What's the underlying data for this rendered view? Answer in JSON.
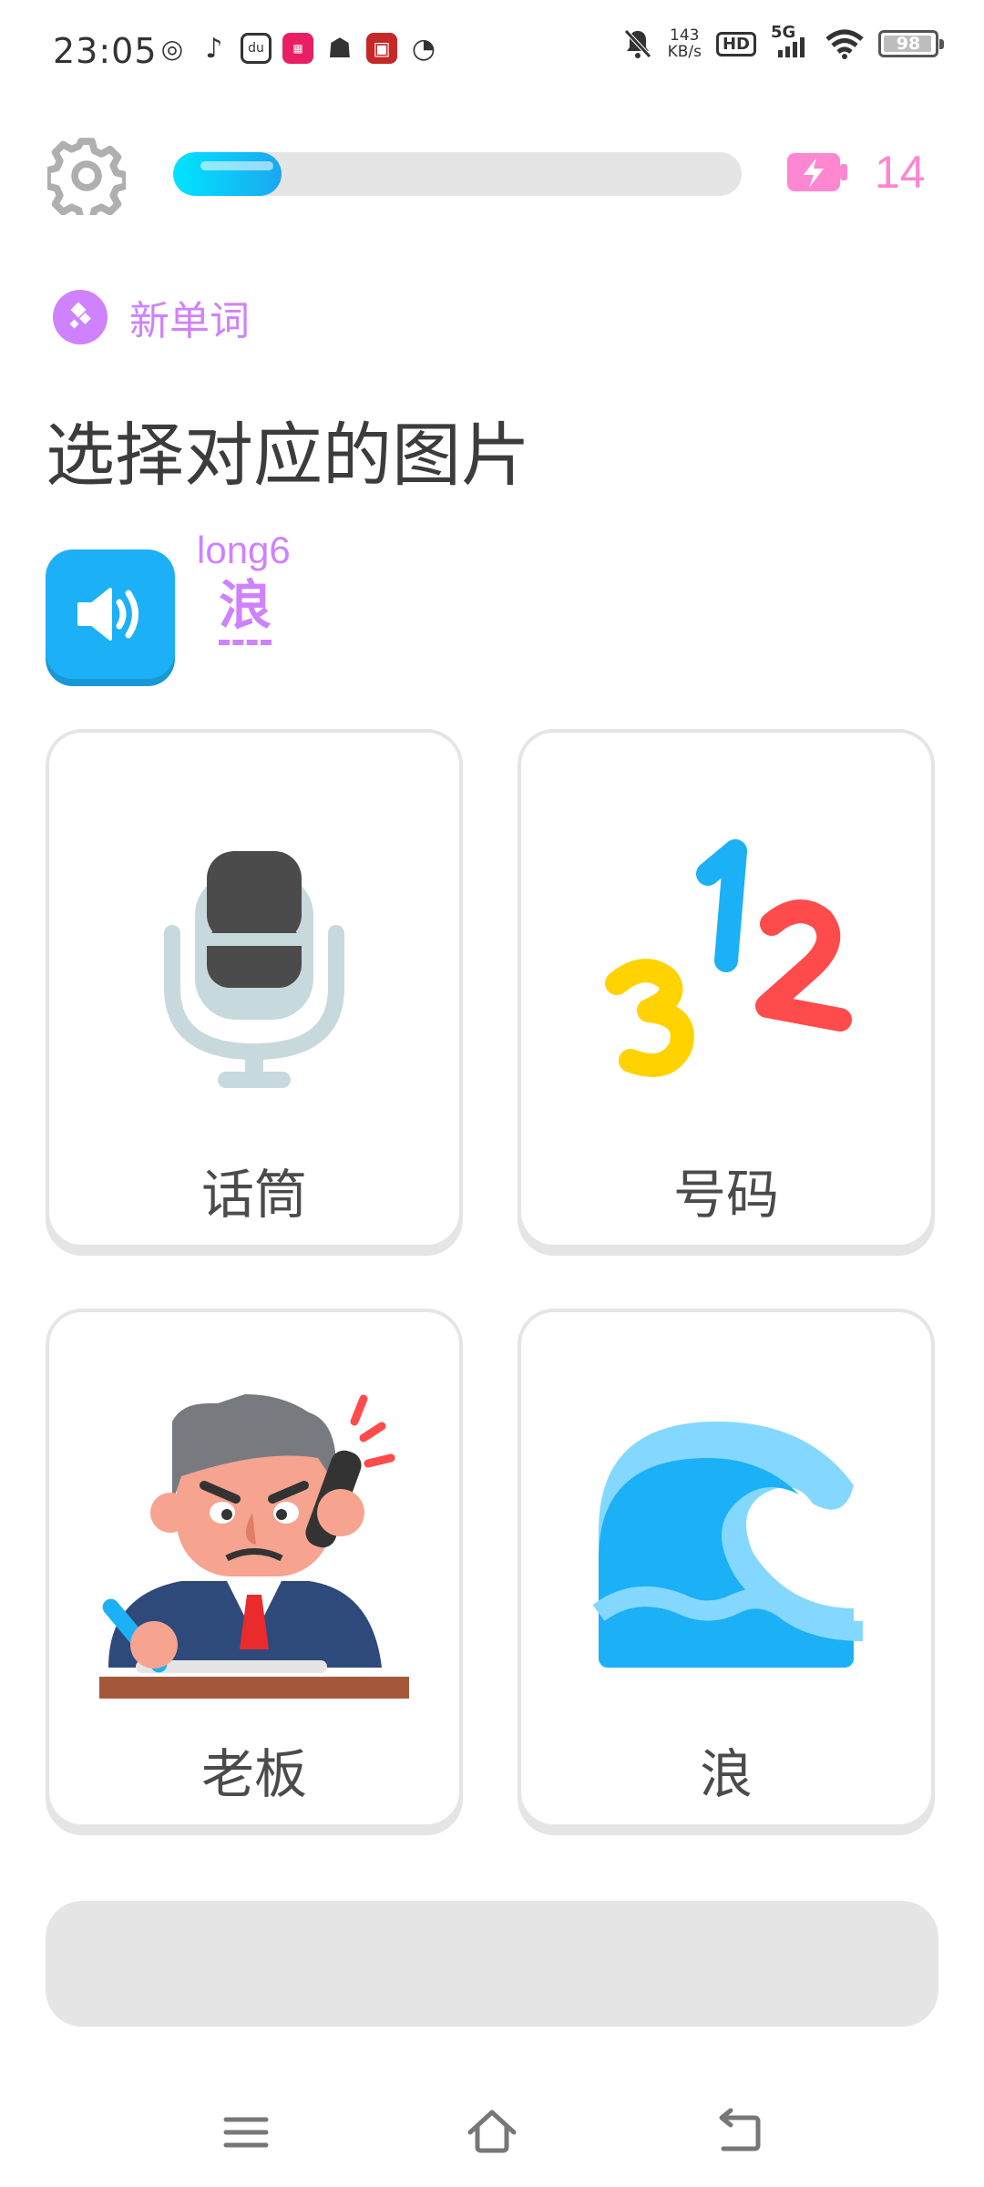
{
  "status_bar": {
    "time": "23:05",
    "net_speed_value": "143",
    "net_speed_unit": "KB/s",
    "hd_label": "HD",
    "network": "5G",
    "battery": "98"
  },
  "header": {
    "progress_fraction": 0.19,
    "energy_count": "14",
    "accent_color": "#1cb0f6",
    "energy_color": "#ff86d0"
  },
  "badge": {
    "label": "新单词"
  },
  "title": "选择对应的图片",
  "prompt": {
    "pinyin": "long6",
    "character": "浪"
  },
  "options": [
    {
      "label": "话筒",
      "icon": "microphone-icon"
    },
    {
      "label": "号码",
      "icon": "numbers-icon"
    },
    {
      "label": "老板",
      "icon": "boss-icon"
    },
    {
      "label": "浪",
      "icon": "wave-icon"
    }
  ],
  "nav": {
    "icons": [
      "menu-icon",
      "home-icon",
      "back-icon"
    ]
  }
}
